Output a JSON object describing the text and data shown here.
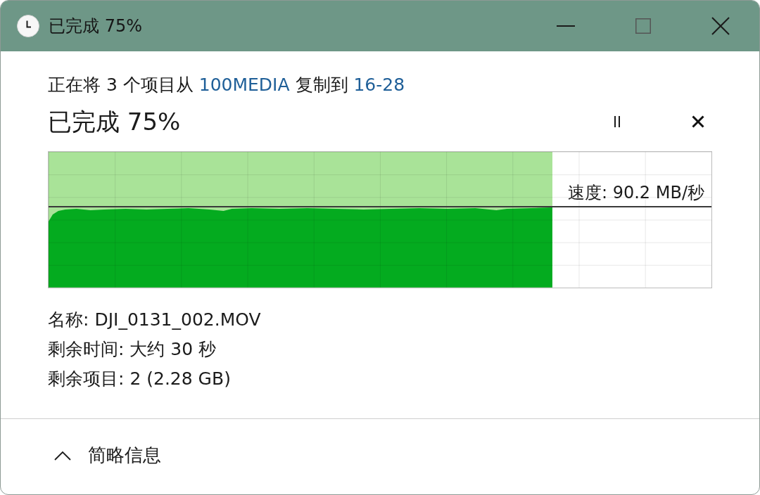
{
  "window": {
    "title": "已完成 75%"
  },
  "copy_summary": {
    "parts": [
      {
        "kind": "text",
        "text": "正在将 3 个项目从 "
      },
      {
        "kind": "link",
        "text": "100MEDIA"
      },
      {
        "kind": "text",
        "text": " 复制到 "
      },
      {
        "kind": "link",
        "text": "16-28"
      }
    ]
  },
  "progress": {
    "heading": "已完成 75%",
    "level": 0.76,
    "speed": "速度: 90.2 MB/秒"
  },
  "details": [
    {
      "label": "名称:",
      "value": "DJI_0131_002.MOV"
    },
    {
      "label": "剩余时间:",
      "value": "大约 30 秒"
    },
    {
      "label": "剩余项目:",
      "value": "2 (2.28 GB)"
    }
  ],
  "footer": {
    "toggle": "简略信息",
    "expanded": true
  }
}
